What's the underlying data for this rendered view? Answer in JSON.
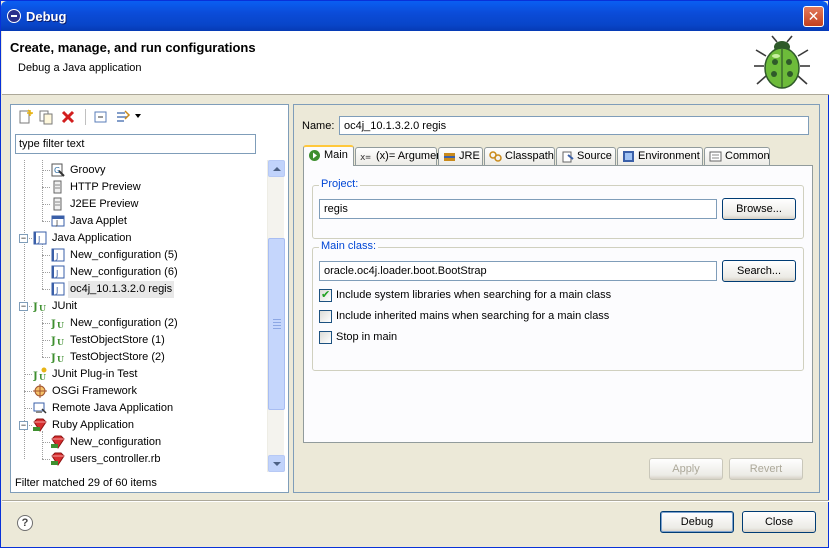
{
  "window": {
    "title": "Debug",
    "close_glyph": "✕"
  },
  "header": {
    "title": "Create, manage, and run configurations",
    "subtitle": "Debug a Java application"
  },
  "left": {
    "filter_value": "type filter text",
    "status": "Filter matched 29 of 60 items",
    "tree": [
      {
        "label": "Groovy",
        "level": 1,
        "icon": "groovy-icon"
      },
      {
        "label": "HTTP Preview",
        "level": 1,
        "icon": "http-preview-icon"
      },
      {
        "label": "J2EE Preview",
        "level": 1,
        "icon": "j2ee-preview-icon"
      },
      {
        "label": "Java Applet",
        "level": 1,
        "icon": "java-applet-icon"
      },
      {
        "label": "Java Application",
        "level": 0,
        "icon": "java-app-icon",
        "expanded": true
      },
      {
        "label": "New_configuration (5)",
        "level": 1,
        "icon": "java-app-icon"
      },
      {
        "label": "New_configuration (6)",
        "level": 1,
        "icon": "java-app-icon"
      },
      {
        "label": "oc4j_10.1.3.2.0 regis",
        "level": 1,
        "icon": "java-app-icon",
        "selected": true
      },
      {
        "label": "JUnit",
        "level": 0,
        "icon": "junit-icon",
        "expanded": true
      },
      {
        "label": "New_configuration (2)",
        "level": 1,
        "icon": "junit-icon"
      },
      {
        "label": "TestObjectStore (1)",
        "level": 1,
        "icon": "junit-icon"
      },
      {
        "label": "TestObjectStore (2)",
        "level": 1,
        "icon": "junit-icon"
      },
      {
        "label": "JUnit Plug-in Test",
        "level": 0,
        "icon": "junit-plugin-icon"
      },
      {
        "label": "OSGi Framework",
        "level": 0,
        "icon": "osgi-icon"
      },
      {
        "label": "Remote Java Application",
        "level": 0,
        "icon": "remote-java-icon"
      },
      {
        "label": "Ruby Application",
        "level": 0,
        "icon": "ruby-icon",
        "expanded": true
      },
      {
        "label": "New_configuration",
        "level": 1,
        "icon": "ruby-icon"
      },
      {
        "label": "users_controller.rb",
        "level": 1,
        "icon": "ruby-icon"
      }
    ]
  },
  "right": {
    "name_label": "Name:",
    "name_value": "oc4j_10.1.3.2.0 regis",
    "tabs": [
      {
        "label": "Main",
        "icon": "main-tab-icon",
        "active": true
      },
      {
        "label": "(x)= Arguments",
        "icon": "arguments-icon"
      },
      {
        "label": "JRE",
        "icon": "jre-icon"
      },
      {
        "label": "Classpath",
        "icon": "classpath-icon"
      },
      {
        "label": "Source",
        "icon": "source-icon"
      },
      {
        "label": "Environment",
        "icon": "environment-icon"
      },
      {
        "label": "Common",
        "icon": "common-icon"
      }
    ],
    "project_label": "Project:",
    "project_value": "regis",
    "browse_label": "Browse...",
    "main_class_label": "Main class:",
    "main_class_value": "oracle.oc4j.loader.boot.BootStrap",
    "search_label": "Search...",
    "options": [
      {
        "label": "Include system libraries when searching for a main class",
        "checked": true
      },
      {
        "label": "Include inherited mains when searching for a main class",
        "checked": false
      },
      {
        "label": "Stop in main",
        "checked": false
      }
    ],
    "apply_label": "Apply",
    "revert_label": "Revert"
  },
  "footer": {
    "help_glyph": "?",
    "debug_label": "Debug",
    "close_label": "Close"
  }
}
